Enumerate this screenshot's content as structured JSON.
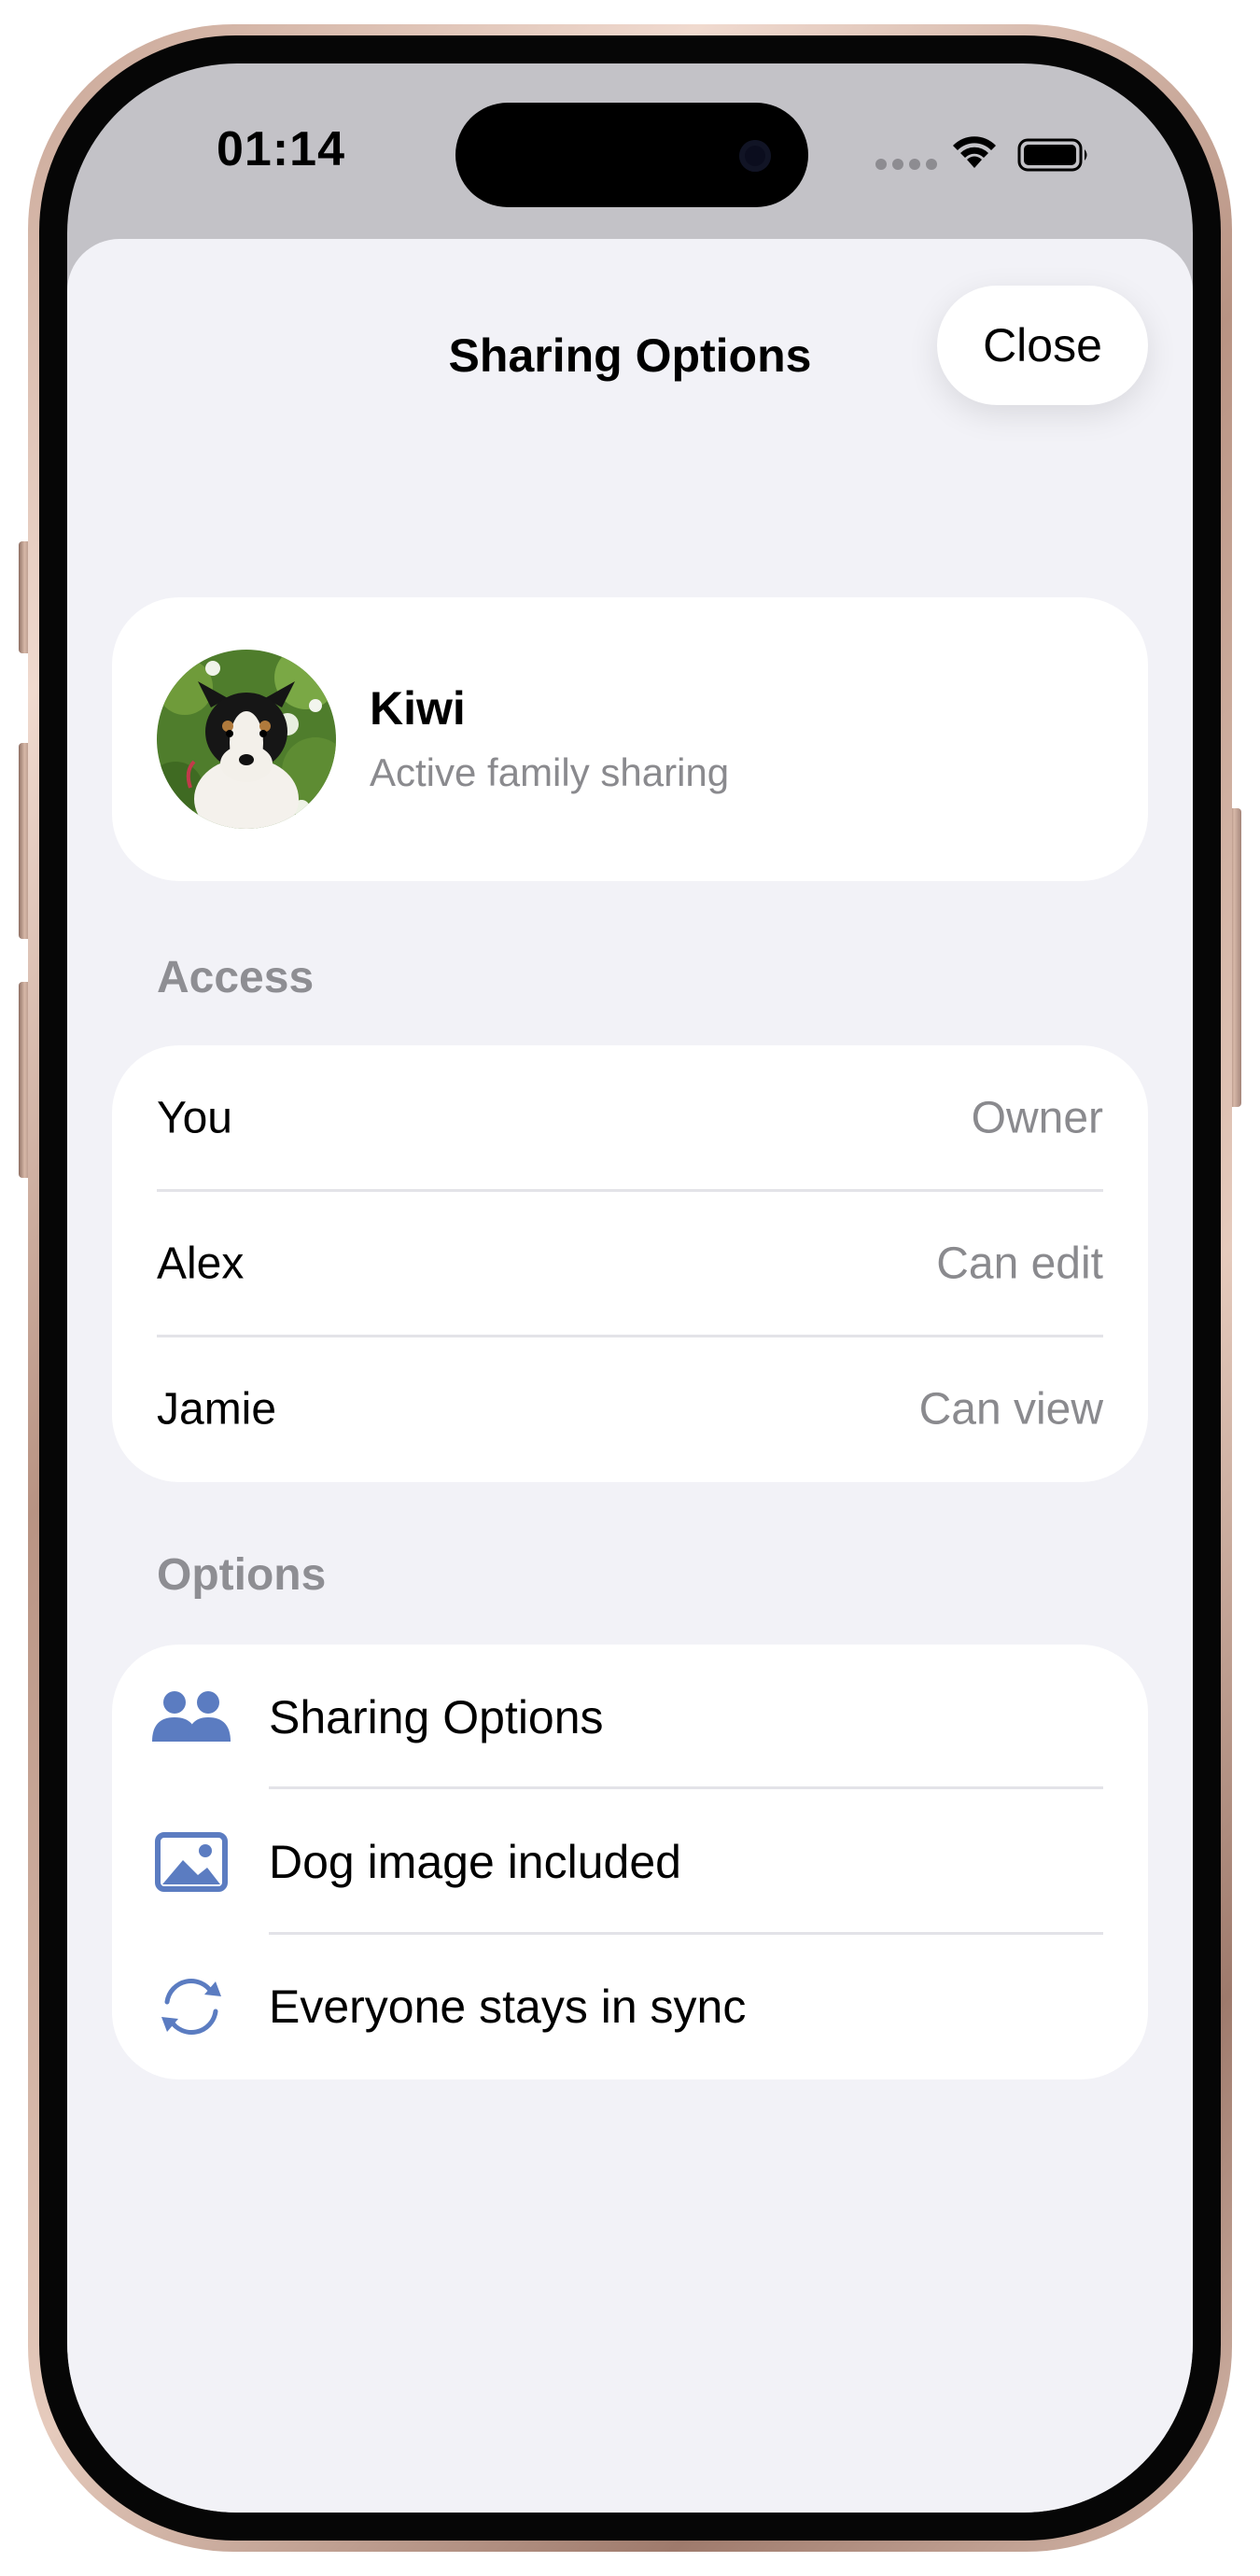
{
  "status_bar": {
    "time": "01:14"
  },
  "sheet": {
    "title": "Sharing Options",
    "close_label": "Close"
  },
  "pet": {
    "name": "Kiwi",
    "status": "Active family sharing"
  },
  "access": {
    "header": "Access",
    "rows": [
      {
        "name": "You",
        "role": "Owner"
      },
      {
        "name": "Alex",
        "role": "Can edit"
      },
      {
        "name": "Jamie",
        "role": "Can view"
      }
    ]
  },
  "options": {
    "header": "Options",
    "items": [
      {
        "icon": "people-icon",
        "label": "Sharing Options"
      },
      {
        "icon": "photo-icon",
        "label": "Dog image included"
      },
      {
        "icon": "sync-icon",
        "label": "Everyone stays in sync"
      }
    ]
  },
  "colors": {
    "accent_icon": "#5b7cc1",
    "sheet_background": "#f2f2f7",
    "secondary_text": "#8a8a8e"
  }
}
